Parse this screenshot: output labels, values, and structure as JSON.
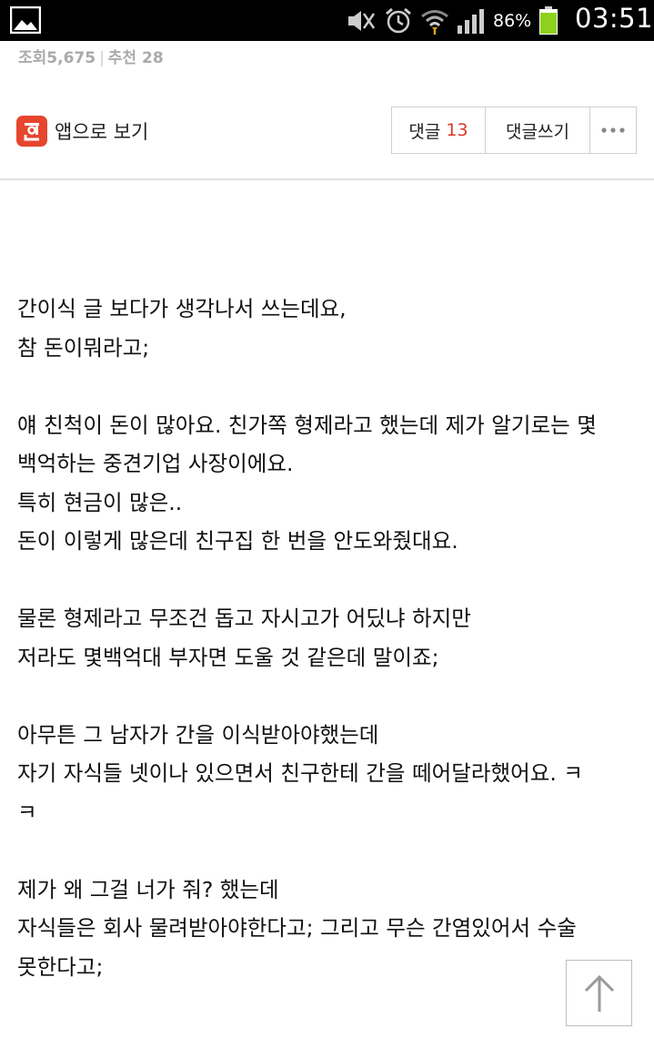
{
  "status_bar": {
    "battery": "86%",
    "time": "03:51",
    "icons": [
      "gallery-icon",
      "mute-icon",
      "alarm-icon",
      "wifi-icon",
      "signal-icon",
      "battery-icon"
    ]
  },
  "stats": {
    "views_label": "조회",
    "views": "5,675",
    "recommend_label": "추천",
    "recommend": "28"
  },
  "app_bar": {
    "app_view_label": "앱으로 보기",
    "comments_label": "댓글",
    "comments_count": "13",
    "write_comment_label": "댓글쓰기",
    "more_label": "···"
  },
  "article": {
    "lines": [
      "간이식 글 보다가 생각나서 쓰는데요,",
      "참 돈이뭐라고;",
      "",
      "얘 친척이 돈이 많아요. 친가쪽 형제라고 했는데 제가 알기로는 몇",
      "백억하는 중견기업 사장이에요.",
      "특히 현금이 많은..",
      "돈이 이렇게 많은데 친구집 한 번을 안도와줬대요.",
      "",
      "물론 형제라고 무조건 돕고 자시고가 어딨냐 하지만",
      "저라도 몇백억대 부자면 도울 것 같은데 말이죠;",
      "",
      "아무튼 그 남자가 간을 이식받아야했는데",
      "자기 자식들 넷이나 있으면서 친구한테 간을 떼어달라했어요. ㅋ",
      "ㅋ",
      "",
      "제가 왜 그걸 너가 줘? 했는데",
      "자식들은 회사 물려받아야한다고; 그리고 무슨 간염있어서 수술",
      "못한다고;"
    ]
  },
  "colors": {
    "accent_red": "#d8392b",
    "logo_red": "#e6462e"
  }
}
